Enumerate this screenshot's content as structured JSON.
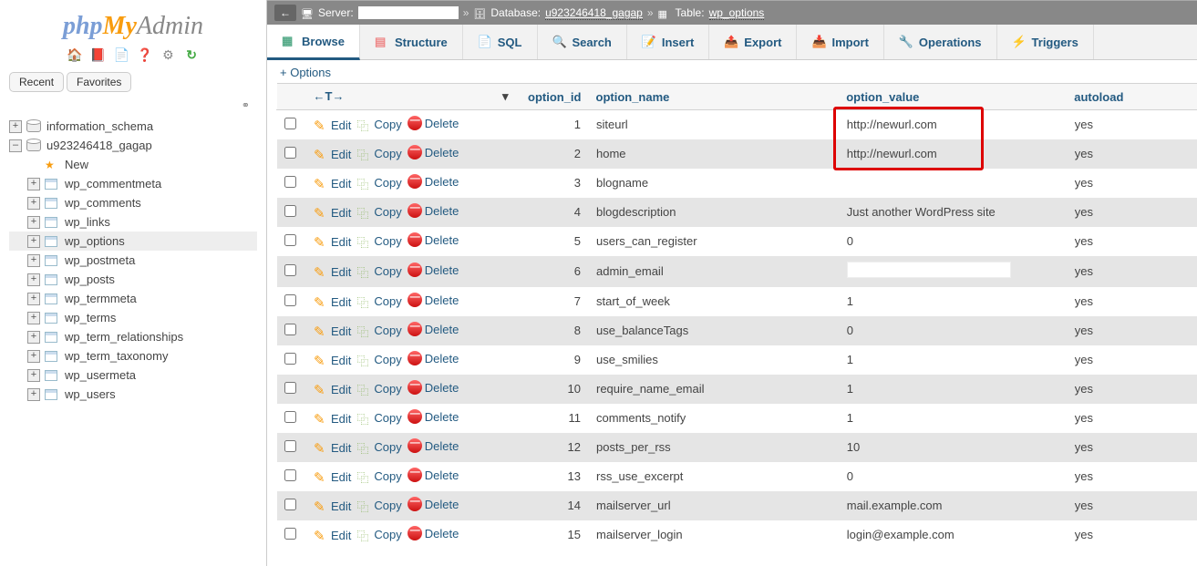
{
  "logo": {
    "php": "php",
    "my": "My",
    "admin": "Admin"
  },
  "nav": {
    "recent": "Recent",
    "favorites": "Favorites",
    "link_glyph": "⚭"
  },
  "tree": {
    "db1": "information_schema",
    "db2": "u923246418_gagap",
    "new": "New",
    "tables": [
      "wp_commentmeta",
      "wp_comments",
      "wp_links",
      "wp_options",
      "wp_postmeta",
      "wp_posts",
      "wp_termmeta",
      "wp_terms",
      "wp_term_relationships",
      "wp_term_taxonomy",
      "wp_usermeta",
      "wp_users"
    ]
  },
  "breadcrumb": {
    "server_label": "Server:",
    "db_label": "Database:",
    "db_name": "u923246418_gagap",
    "table_label": "Table:",
    "table_name": "wp_options"
  },
  "tabs": {
    "browse": "Browse",
    "structure": "Structure",
    "sql": "SQL",
    "search": "Search",
    "insert": "Insert",
    "export": "Export",
    "import": "Import",
    "operations": "Operations",
    "triggers": "Triggers"
  },
  "options_link": "+ Options",
  "headers": {
    "nav": "←T→",
    "option_id": "option_id",
    "option_name": "option_name",
    "option_value": "option_value",
    "autoload": "autoload"
  },
  "actions": {
    "edit": "Edit",
    "copy": "Copy",
    "delete": "Delete"
  },
  "rows": [
    {
      "id": "1",
      "name": "siteurl",
      "value": "http://newurl.com",
      "autoload": "yes",
      "hl": true
    },
    {
      "id": "2",
      "name": "home",
      "value": "http://newurl.com",
      "autoload": "yes",
      "hl": true
    },
    {
      "id": "3",
      "name": "blogname",
      "value": "",
      "autoload": "yes"
    },
    {
      "id": "4",
      "name": "blogdescription",
      "value": "Just another WordPress site",
      "autoload": "yes"
    },
    {
      "id": "5",
      "name": "users_can_register",
      "value": "0",
      "autoload": "yes"
    },
    {
      "id": "6",
      "name": "admin_email",
      "value": "",
      "autoload": "yes",
      "blank": true
    },
    {
      "id": "7",
      "name": "start_of_week",
      "value": "1",
      "autoload": "yes"
    },
    {
      "id": "8",
      "name": "use_balanceTags",
      "value": "0",
      "autoload": "yes"
    },
    {
      "id": "9",
      "name": "use_smilies",
      "value": "1",
      "autoload": "yes"
    },
    {
      "id": "10",
      "name": "require_name_email",
      "value": "1",
      "autoload": "yes"
    },
    {
      "id": "11",
      "name": "comments_notify",
      "value": "1",
      "autoload": "yes"
    },
    {
      "id": "12",
      "name": "posts_per_rss",
      "value": "10",
      "autoload": "yes"
    },
    {
      "id": "13",
      "name": "rss_use_excerpt",
      "value": "0",
      "autoload": "yes"
    },
    {
      "id": "14",
      "name": "mailserver_url",
      "value": "mail.example.com",
      "autoload": "yes"
    },
    {
      "id": "15",
      "name": "mailserver_login",
      "value": "login@example.com",
      "autoload": "yes"
    }
  ]
}
